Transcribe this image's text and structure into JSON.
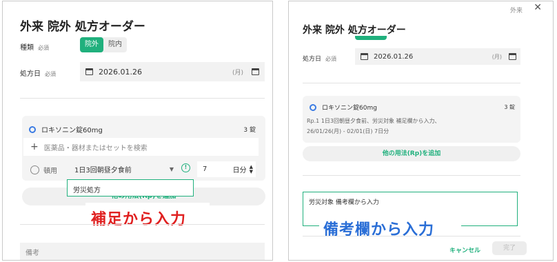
{
  "left": {
    "title": "外来 院外 処方オーダー",
    "type_label": "種類",
    "required": "必須",
    "type_options": [
      "院外",
      "院内"
    ],
    "date_label": "処方日",
    "date_value": "2026.01.26",
    "date_weekday": "(月)",
    "drug_name": "ロキソニン錠60mg",
    "drug_qty": "3 錠",
    "search_placeholder": "医薬品・器材またはセットを検索",
    "timing_label": "頓用",
    "usage_value": "1日3回朝昼夕食前",
    "days_value": "7",
    "days_unit": "日分",
    "popup_text": "労災処方",
    "add_rp_label": "他の用法(Rp)を追加",
    "remarks_label": "備考",
    "annotation": "補足から入力"
  },
  "right": {
    "close_label": "外来",
    "title": "外来 院外 処方オーダー",
    "date_label": "処方日",
    "required": "必須",
    "date_value": "2026.01.26",
    "date_weekday": "(月)",
    "drug_name": "ロキソニン錠60mg",
    "drug_qty": "3 錠",
    "rp_line1": "Rp.1  1日3回朝昼夕食前、労災対象   補足欄から入力、",
    "rp_line2": "26/01/26(月) - 02/01(日) 7日分",
    "add_rp_label": "他の用法(Rp)を追加",
    "remarks_value": "労災対象   備考欄から入力",
    "annotation": "備考欄から入力",
    "cancel_label": "キャンセル",
    "done_label": "完了"
  },
  "colors": {
    "accent": "#20b07d",
    "annotation_red": "#e02020",
    "annotation_blue": "#2a6ed6",
    "pill_blue": "#3b7be3"
  }
}
